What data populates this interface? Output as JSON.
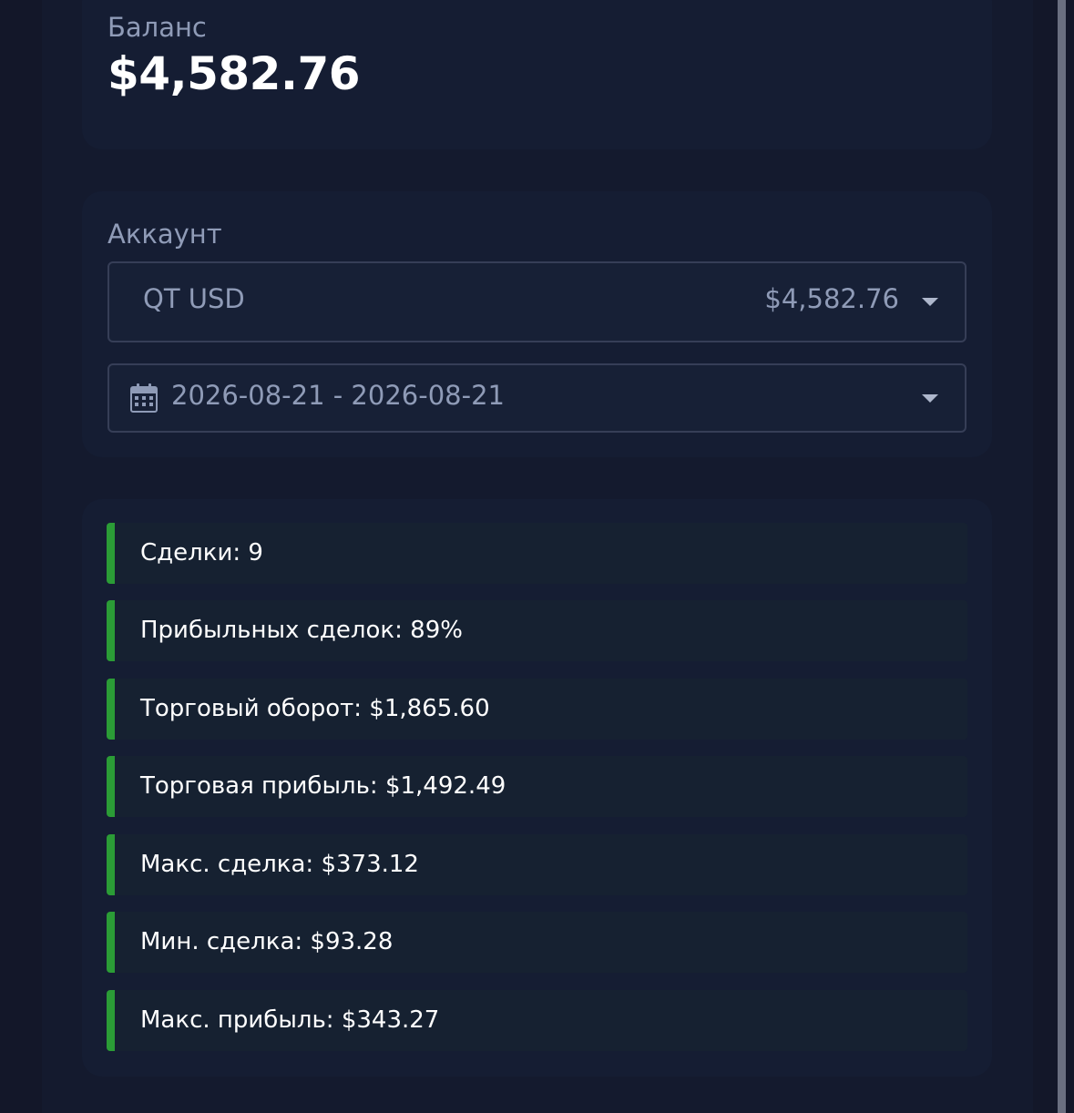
{
  "balance": {
    "label": "Баланс",
    "value": "$4,582.76"
  },
  "account": {
    "label": "Аккаунт",
    "selected_name": "QT USD",
    "selected_amount": "$4,582.76",
    "date_range": "2026-08-21 - 2026-08-21"
  },
  "stats": [
    {
      "label": "Сделки",
      "value": "9",
      "text": "Сделки: 9"
    },
    {
      "label": "Прибыльных сделок",
      "value": "89%",
      "text": "Прибыльных сделок: 89%"
    },
    {
      "label": "Торговый оборот",
      "value": "$1,865.60",
      "text": "Торговый оборот: $1,865.60"
    },
    {
      "label": "Торговая прибыль",
      "value": "$1,492.49",
      "text": "Торговая прибыль: $1,492.49"
    },
    {
      "label": "Макс. сделка",
      "value": "$373.12",
      "text": "Макс. сделка: $373.12"
    },
    {
      "label": "Мин. сделка",
      "value": "$93.28",
      "text": "Мин. сделка: $93.28"
    },
    {
      "label": "Макс. прибыль",
      "value": "$343.27",
      "text": "Макс. прибыль: $343.27"
    }
  ],
  "colors": {
    "background": "#131729",
    "card": "#151d33",
    "stat_card": "#162131",
    "accent": "#2b9c36",
    "text_muted": "#8f9bb7",
    "text_primary": "#ffffff",
    "border": "#363e57"
  },
  "icons": {
    "calendar": "calendar-icon",
    "dropdown": "caret-down-icon"
  }
}
